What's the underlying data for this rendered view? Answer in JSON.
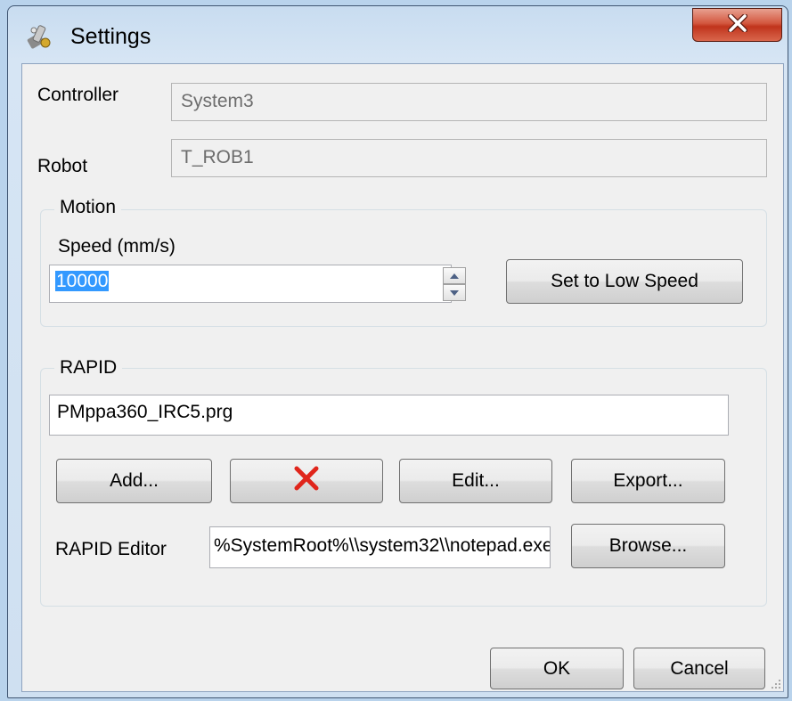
{
  "window": {
    "title": "Settings",
    "title_icon": "settings-app-icon",
    "close_icon": "close-icon"
  },
  "controller": {
    "label": "Controller",
    "value": "System3"
  },
  "robot": {
    "label": "Robot",
    "value": "T_ROB1"
  },
  "motion": {
    "group_title": "Motion",
    "speed_label": "Speed (mm/s)",
    "speed_value": "10000",
    "low_speed_button": "Set to Low Speed"
  },
  "rapid": {
    "group_title": "RAPID",
    "file_value": "PMppa360_IRC5.prg",
    "add_button": "Add...",
    "delete_icon": "red-x-delete-icon",
    "edit_button": "Edit...",
    "export_button": "Export...",
    "editor_label": "RAPID Editor",
    "editor_path": "%SystemRoot%\\\\system32\\\\notepad.exe",
    "browse_button": "Browse..."
  },
  "footer": {
    "ok_button": "OK",
    "cancel_button": "Cancel"
  },
  "colors": {
    "close_button": "#c9462c",
    "selection": "#3399ff",
    "delete_x": "#e0251b"
  }
}
